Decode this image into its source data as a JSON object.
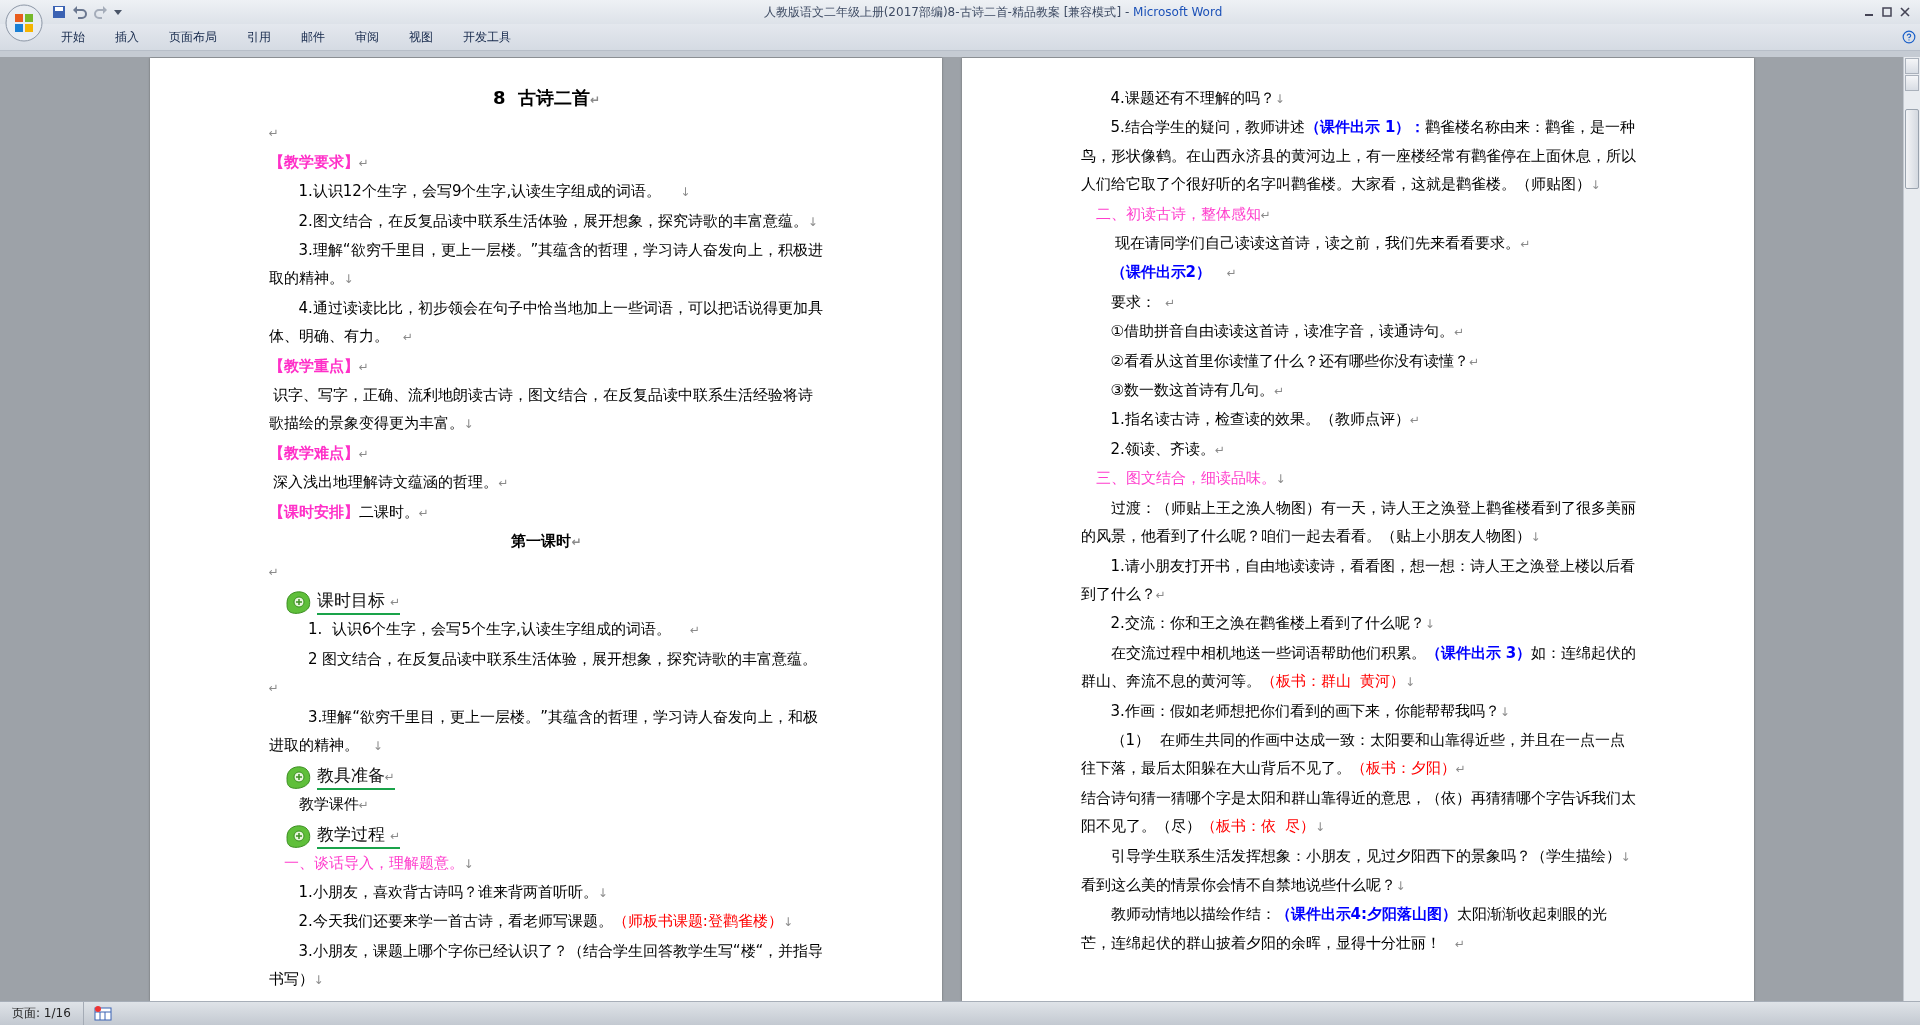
{
  "window": {
    "title": "人教版语文二年级上册(2017部编)8-古诗二首-精品教案 [兼容模式] - ",
    "app": "Microsoft Word"
  },
  "ribbon_tabs": [
    {
      "label": "开始",
      "selected": false
    },
    {
      "label": "插入",
      "selected": false
    },
    {
      "label": "页面布局",
      "selected": false
    },
    {
      "label": "引用",
      "selected": false
    },
    {
      "label": "邮件",
      "selected": false
    },
    {
      "label": "审阅",
      "selected": false
    },
    {
      "label": "视图",
      "selected": false
    },
    {
      "label": "开发工具",
      "selected": false
    }
  ],
  "pages": [
    {
      "paragraphs": [
        {
          "kind": "title",
          "runs": [
            {
              "text": "8  古诗二首",
              "kind": "plain"
            }
          ],
          "mark": "↵"
        },
        {
          "kind": "blank",
          "mark": "↵"
        },
        {
          "kind": "flush",
          "runs": [
            {
              "text": "【教学要求】",
              "kind": "heading"
            }
          ],
          "mark": "↵"
        },
        {
          "kind": "item",
          "runs": [
            {
              "text": "1.认识12个生字，会写9个生字,认读生字组成的词语。    ",
              "kind": "plain"
            }
          ],
          "mark": "↓"
        },
        {
          "kind": "item",
          "runs": [
            {
              "text": "2.图文结合，在反复品读中联系生活体验，展开想象，探究诗歌的丰富意蕴。",
              "kind": "plain"
            }
          ],
          "mark": "↓"
        },
        {
          "kind": "item",
          "runs": [
            {
              "text": "3.理解“欲穷千里目，更上一层楼。”其蕴含的哲理，学习诗人奋发向上，积极进取的精神。",
              "kind": "plain"
            }
          ],
          "mark": "↓"
        },
        {
          "kind": "item",
          "runs": [
            {
              "text": "4.通过读读比比，初步领会在句子中恰当地加上一些词语，可以把话说得更加具体、明确、有力。   ",
              "kind": "plain"
            }
          ],
          "mark": "↵"
        },
        {
          "kind": "flush",
          "runs": [
            {
              "text": "【教学重点】",
              "kind": "heading"
            }
          ],
          "mark": "↵"
        },
        {
          "kind": "flush",
          "runs": [
            {
              "text": " 识字、写字，正确、流利地朗读古诗，图文结合，在反复品读中联系生活经验将诗歌描绘的景象变得更为丰富。",
              "kind": "plain"
            }
          ],
          "mark": "↓"
        },
        {
          "kind": "flush",
          "runs": [
            {
              "text": "【教学难点】",
              "kind": "heading"
            }
          ],
          "mark": "↵"
        },
        {
          "kind": "flush",
          "runs": [
            {
              "text": " 深入浅出地理解诗文蕴涵的哲理。",
              "kind": "plain"
            }
          ],
          "mark": "↵"
        },
        {
          "kind": "flush",
          "runs": [
            {
              "text": "【课时安排】",
              "kind": "heading"
            },
            {
              "text": "二课时。",
              "kind": "plain"
            }
          ],
          "mark": "↵"
        },
        {
          "kind": "lesson",
          "runs": [
            {
              "text": "第一课时",
              "kind": "plain"
            }
          ],
          "mark": "↵"
        },
        {
          "kind": "blank",
          "mark": "↵"
        },
        {
          "kind": "icon-heading",
          "runs": [
            {
              "text": "课时目标 ",
              "kind": "plain"
            }
          ],
          "mark": "↵"
        },
        {
          "kind": "item",
          "runs": [
            {
              "text": "  1.  认识6个生字，会写5个生字,认读生字组成的词语。    ",
              "kind": "plain"
            }
          ],
          "mark": "↵"
        },
        {
          "kind": "item",
          "runs": [
            {
              "text": "  2 图文结合，在反复品读中联系生活体验，展开想象，探究诗歌的丰富意蕴。 ",
              "kind": "plain"
            }
          ],
          "mark": "↵"
        },
        {
          "kind": "item",
          "runs": [
            {
              "text": "  3.理解“欲穷千里目，更上一层楼。”其蕴含的哲理，学习诗人奋发向上，和极进取的精神。   ",
              "kind": "plain"
            }
          ],
          "mark": "↓"
        },
        {
          "kind": "icon-heading",
          "runs": [
            {
              "text": "教具准备",
              "kind": "plain"
            }
          ],
          "mark": "↵"
        },
        {
          "kind": "item",
          "runs": [
            {
              "text": "教学课件",
              "kind": "plain"
            }
          ],
          "mark": "↵"
        },
        {
          "kind": "icon-heading",
          "runs": [
            {
              "text": "教学过程 ",
              "kind": "plain"
            }
          ],
          "mark": "↵"
        },
        {
          "kind": "section",
          "runs": [
            {
              "text": "一、谈话导入，理解题意。",
              "kind": "pink"
            }
          ],
          "mark": "↓"
        },
        {
          "kind": "item",
          "runs": [
            {
              "text": "1.小朋友，喜欢背古诗吗？谁来背两首听听。",
              "kind": "plain"
            }
          ],
          "mark": "↓"
        },
        {
          "kind": "item",
          "runs": [
            {
              "text": "2.今天我们还要来学一首古诗，看老师写课题。",
              "kind": "plain"
            },
            {
              "text": "（师板书课题:登鹳雀楼）",
              "kind": "red"
            }
          ],
          "mark": "↓"
        },
        {
          "kind": "item",
          "runs": [
            {
              "text": "3.小朋友，课题上哪个字你已经认识了？（结合学生回答教学生写“楼“，并指导书写）",
              "kind": "plain"
            }
          ],
          "mark": "↓"
        }
      ]
    },
    {
      "paragraphs": [
        {
          "kind": "item",
          "runs": [
            {
              "text": "4.课题还有不理解的吗？",
              "kind": "plain"
            }
          ],
          "mark": "↓"
        },
        {
          "kind": "item",
          "runs": [
            {
              "text": "5.结合学生的疑问，教师讲述",
              "kind": "plain"
            },
            {
              "text": "（课件出示 1）：",
              "kind": "blue"
            },
            {
              "text": "鹳雀楼名称由来：鹳雀，是一种鸟，形状像鹤。在山西永济县的黄河边上，有一座楼经常有鹳雀停在上面休息，所以人们给它取了个很好听的名字叫鹳雀楼。大家看，这就是鹳雀楼。（师贴图）",
              "kind": "plain"
            }
          ],
          "mark": "↓"
        },
        {
          "kind": "section",
          "runs": [
            {
              "text": "二、初读古诗，整体感知",
              "kind": "pink"
            }
          ],
          "mark": "↵"
        },
        {
          "kind": "item",
          "runs": [
            {
              "text": " 现在请同学们自己读读这首诗，读之前，我们先来看看要求。",
              "kind": "plain"
            }
          ],
          "mark": "↵"
        },
        {
          "kind": "item",
          "runs": [
            {
              "text": "（课件出示2）   ",
              "kind": "blue"
            }
          ],
          "mark": "↵"
        },
        {
          "kind": "item",
          "runs": [
            {
              "text": "要求：  ",
              "kind": "plain"
            }
          ],
          "mark": "↵"
        },
        {
          "kind": "item",
          "runs": [
            {
              "text": "①借助拼音自由读读这首诗，读准字音，读通诗句。",
              "kind": "plain"
            }
          ],
          "mark": "↵"
        },
        {
          "kind": "item",
          "runs": [
            {
              "text": "②看看从这首里你读懂了什么？还有哪些你没有读懂？",
              "kind": "plain"
            }
          ],
          "mark": "↵"
        },
        {
          "kind": "item",
          "runs": [
            {
              "text": "③数一数这首诗有几句。",
              "kind": "plain"
            }
          ],
          "mark": "↵"
        },
        {
          "kind": "item",
          "runs": [
            {
              "text": "1.指名读古诗，检查读的效果。（教师点评）",
              "kind": "plain"
            }
          ],
          "mark": "↵"
        },
        {
          "kind": "item",
          "runs": [
            {
              "text": "2.领读、齐读。",
              "kind": "plain"
            }
          ],
          "mark": "↵"
        },
        {
          "kind": "section",
          "runs": [
            {
              "text": "三、图文结合，细读品味。",
              "kind": "pink"
            }
          ],
          "mark": "↓"
        },
        {
          "kind": "item",
          "runs": [
            {
              "text": "过渡：（师贴上王之涣人物图）有一天，诗人王之涣登上鹳雀楼看到了很多美丽的风景，他看到了什么呢？咱们一起去看看。（贴上小朋友人物图）",
              "kind": "plain"
            }
          ],
          "mark": "↓"
        },
        {
          "kind": "item",
          "runs": [
            {
              "text": "1.请小朋友打开书，自由地读读诗，看看图，想一想：诗人王之涣登上楼以后看到了什么？",
              "kind": "plain"
            }
          ],
          "mark": "↵"
        },
        {
          "kind": "item",
          "runs": [
            {
              "text": "2.交流：你和王之涣在鹳雀楼上看到了什么呢？",
              "kind": "plain"
            }
          ],
          "mark": "↓"
        },
        {
          "kind": "item",
          "runs": [
            {
              "text": "在交流过程中相机地送一些词语帮助他们积累。",
              "kind": "plain"
            },
            {
              "text": "（课件出示 3）",
              "kind": "blue"
            },
            {
              "text": "如：连绵起伏的群山、奔流不息的黄河等。",
              "kind": "plain"
            },
            {
              "text": "（板书：群山  黄河）",
              "kind": "red"
            }
          ],
          "mark": "↓"
        },
        {
          "kind": "item",
          "runs": [
            {
              "text": "3.作画：假如老师想把你们看到的画下来，你能帮帮我吗？",
              "kind": "plain"
            }
          ],
          "mark": "↓"
        },
        {
          "kind": "item",
          "runs": [
            {
              "text": "（1）  在师生共同的作画中达成一致：太阳要和山靠得近些，并且在一点一点往下落，最后太阳躲在大山背后不见了。",
              "kind": "plain"
            },
            {
              "text": "（板书：夕阳）",
              "kind": "red"
            }
          ],
          "mark": "↵"
        },
        {
          "kind": "flush",
          "runs": [
            {
              "text": "结合诗句猜一猜哪个字是太阳和群山靠得近的意思，（依）再猜猜哪个字告诉我们太阳不见了。（尽）",
              "kind": "plain"
            },
            {
              "text": "（板书：依  尽）",
              "kind": "red"
            }
          ],
          "mark": "↓"
        },
        {
          "kind": "item",
          "runs": [
            {
              "text": "引导学生联系生活发挥想象：小朋友，见过夕阳西下的景象吗？（学生描绘）",
              "kind": "plain"
            }
          ],
          "mark": "↓"
        },
        {
          "kind": "flush",
          "runs": [
            {
              "text": "看到这么美的情景你会情不自禁地说些什么呢？",
              "kind": "plain"
            }
          ],
          "mark": "↓"
        },
        {
          "kind": "item",
          "runs": [
            {
              "text": "教师动情地以描绘作结：",
              "kind": "plain"
            },
            {
              "text": "（课件出示4:夕阳落山图）",
              "kind": "blue"
            },
            {
              "text": "太阳渐渐收起刺眼的光芒，连绵起伏的群山披着夕阳的余晖，显得十分壮丽！   ",
              "kind": "plain"
            }
          ],
          "mark": "↵"
        }
      ]
    }
  ],
  "status_bar": {
    "page": "页面: 1/16"
  }
}
